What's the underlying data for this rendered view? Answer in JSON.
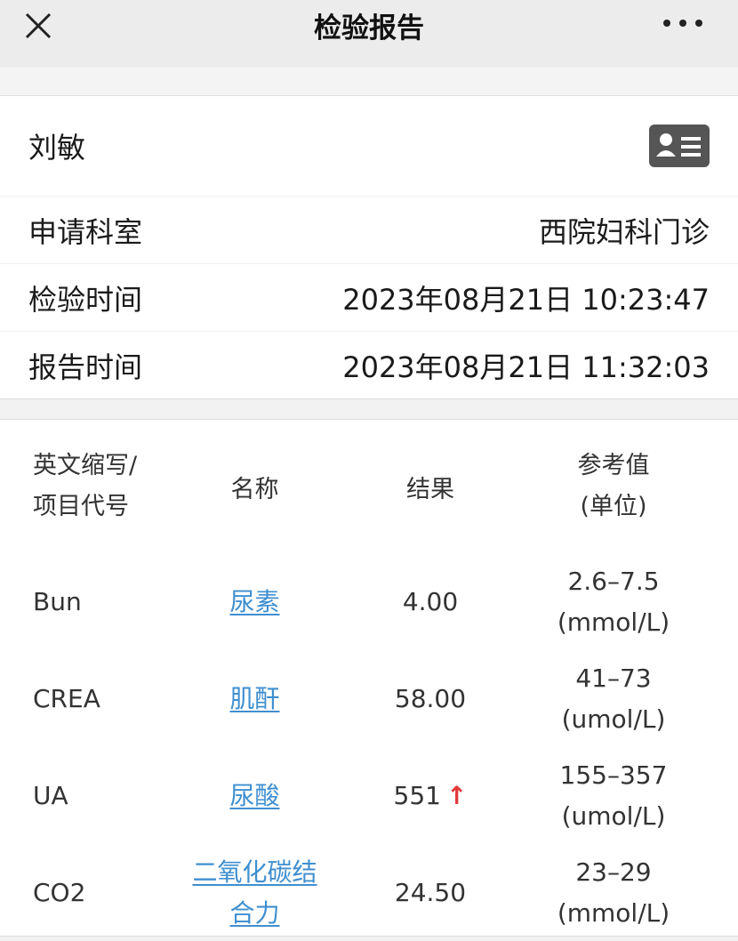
{
  "header": {
    "title": "检验报告",
    "close_icon": "close-icon",
    "more_icon": "more-dots-icon"
  },
  "patient": {
    "name": "刘敏",
    "card_icon": "id-card-icon"
  },
  "info": [
    {
      "label": "申请科室",
      "value": "西院妇科门诊"
    },
    {
      "label": "检验时间",
      "value": "2023年08月21日 10:23:47"
    },
    {
      "label": "报告时间",
      "value": "2023年08月21日 11:32:03"
    }
  ],
  "table": {
    "headers": {
      "abbr_line1": "英文缩写/",
      "abbr_line2": "项目代号",
      "name": "名称",
      "result": "结果",
      "ref_line1": "参考值",
      "ref_line2": "(单位)"
    },
    "rows": [
      {
        "code": "Bun",
        "name": "尿素",
        "result": "4.00",
        "flag": "",
        "range": "2.6–7.5",
        "unit": "(mmol/L)"
      },
      {
        "code": "CREA",
        "name": "肌酐",
        "result": "58.00",
        "flag": "",
        "range": "41–73",
        "unit": "(umol/L)"
      },
      {
        "code": "UA",
        "name": "尿酸",
        "result": "551",
        "flag": "↑",
        "range": "155–357",
        "unit": "(umol/L)"
      },
      {
        "code": "CO2",
        "name_line1": "二氧化碳结",
        "name_line2": "合力",
        "result": "24.50",
        "flag": "",
        "range": "23–29",
        "unit": "(mmol/L)"
      }
    ]
  },
  "colors": {
    "link": "#3f8fd0",
    "abnormal_high": "#e23b3b"
  }
}
